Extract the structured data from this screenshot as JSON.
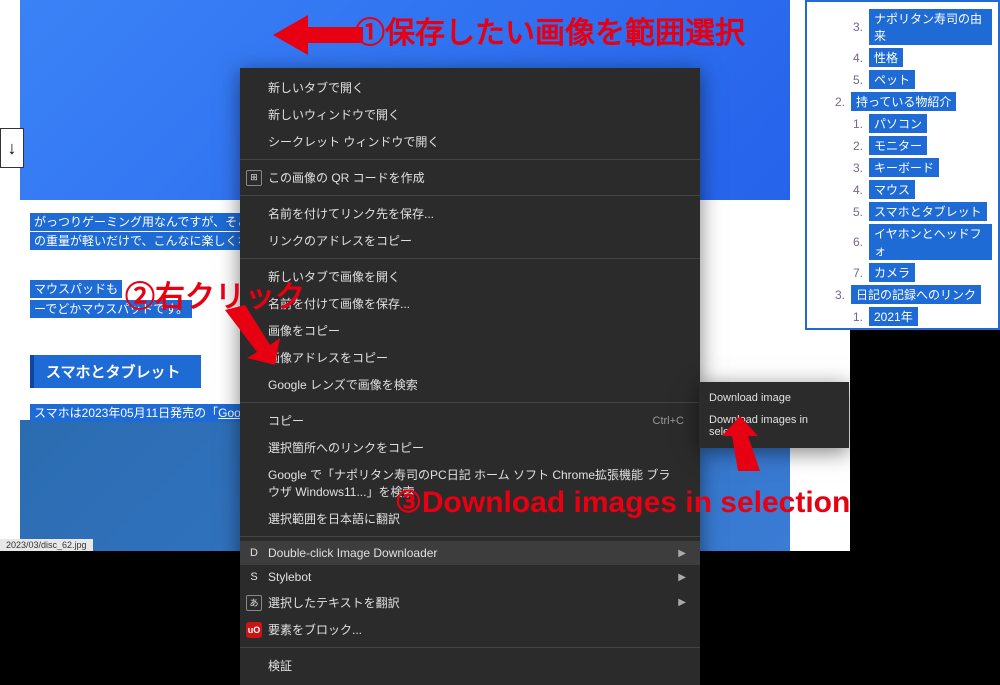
{
  "annotations": {
    "step1": "①保存したい画像を範囲選択",
    "step2": "②右クリック",
    "step3": "③Download images in selection"
  },
  "scroll_arrow": "↓",
  "page_text": {
    "line1": "がっつりゲーミング用なんですが、そこ",
    "line2": "の重量が軽いだけで、こんなに楽しくな",
    "line3": "マウスパッドも",
    "line4": "ーでどかマウスパッドです。",
    "section_header": "スマホとタブレット",
    "line5_prefix": "スマホは2023年05月11日発売の「",
    "line5_link": "Goog"
  },
  "sidebar": {
    "items": [
      {
        "indent": 2,
        "num": "3.",
        "label": "ナポリタン寿司の由来"
      },
      {
        "indent": 2,
        "num": "4.",
        "label": "性格"
      },
      {
        "indent": 2,
        "num": "5.",
        "label": "ペット"
      },
      {
        "indent": 1,
        "num": "2.",
        "label": "持っている物紹介"
      },
      {
        "indent": 2,
        "num": "1.",
        "label": "パソコン"
      },
      {
        "indent": 2,
        "num": "2.",
        "label": "モニター"
      },
      {
        "indent": 2,
        "num": "3.",
        "label": "キーボード"
      },
      {
        "indent": 2,
        "num": "4.",
        "label": "マウス"
      },
      {
        "indent": 2,
        "num": "5.",
        "label": "スマホとタブレット"
      },
      {
        "indent": 2,
        "num": "6.",
        "label": "イヤホンとヘッドフォ"
      },
      {
        "indent": 2,
        "num": "7.",
        "label": "カメラ"
      },
      {
        "indent": 1,
        "num": "3.",
        "label": "日記の記録へのリンク"
      },
      {
        "indent": 2,
        "num": "1.",
        "label": "2021年"
      }
    ]
  },
  "context_menu": {
    "group1": [
      "新しいタブで開く",
      "新しいウィンドウで開く",
      "シークレット ウィンドウで開く"
    ],
    "qr": "この画像の QR コードを作成",
    "group2": [
      "名前を付けてリンク先を保存...",
      "リンクのアドレスをコピー"
    ],
    "group3": [
      "新しいタブで画像を開く",
      "名前を付けて画像を保存...",
      "画像をコピー",
      "画像アドレスをコピー",
      "Google レンズで画像を検索"
    ],
    "copy": {
      "label": "コピー",
      "shortcut": "Ctrl+C"
    },
    "group4": [
      "選択箇所へのリンクをコピー",
      "Google で「ナポリタン寿司のPC日記 ホーム ソフト Chrome拡張機能 ブラウザ Windows11...」を検索",
      "選択範囲を日本語に翻訳"
    ],
    "ext1": {
      "icon": "D",
      "label": "Double-click Image Downloader"
    },
    "ext2": {
      "icon": "S",
      "label": "Stylebot"
    },
    "ext3": {
      "label": "選択したテキストを翻訳"
    },
    "ext4": {
      "label": "要素をブロック..."
    },
    "inspect": "検証"
  },
  "submenu": {
    "item1": "Download image",
    "item2": "Download images in selection"
  },
  "status": "2023/03/disc_62.jpg"
}
